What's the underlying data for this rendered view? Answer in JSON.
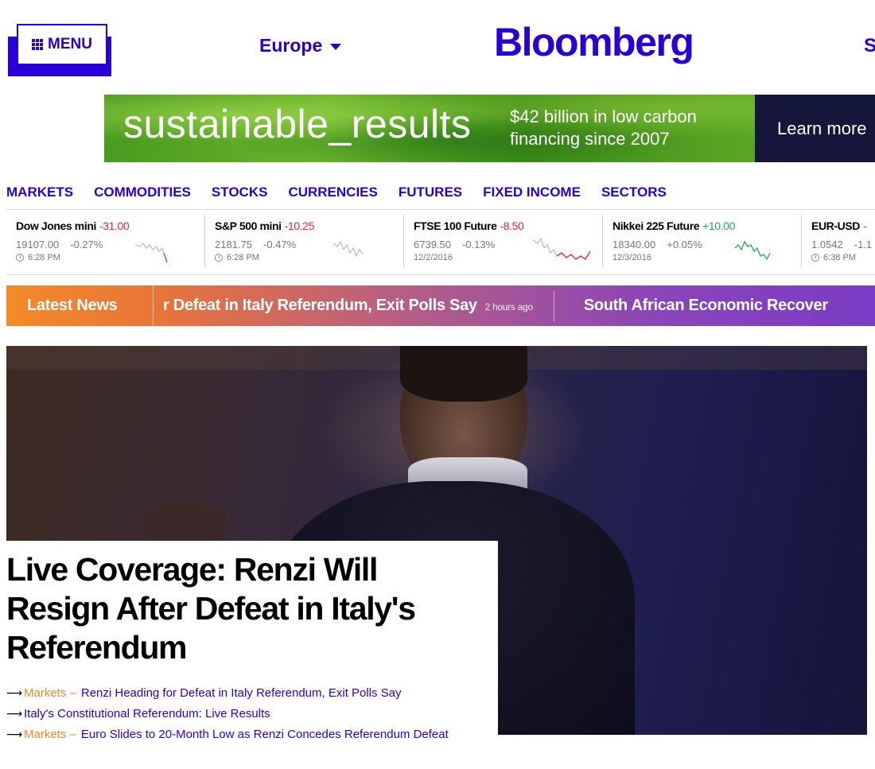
{
  "header": {
    "menu_label": "MENU",
    "region": "Europe",
    "logo": "Bloomberg",
    "edge_text": "S"
  },
  "ad": {
    "headline": "sustainable_results",
    "sub_line1": "$42 billion in low carbon",
    "sub_line2": "financing since 2007",
    "cta": "Learn more",
    "colors": {
      "green": "#5aa624",
      "dark": "#14163a"
    }
  },
  "nav": {
    "items": [
      "MARKETS",
      "COMMODITIES",
      "STOCKS",
      "CURRENCIES",
      "FUTURES",
      "FIXED INCOME",
      "SECTORS"
    ]
  },
  "tickers": [
    {
      "name": "Dow Jones mini",
      "change": "-31.00",
      "direction": "down",
      "price": "19107.00",
      "pct": "-0.27%",
      "time": "6:28 PM",
      "show_clock": true
    },
    {
      "name": "S&P 500 mini",
      "change": "-10.25",
      "direction": "down",
      "price": "2181.75",
      "pct": "-0.47%",
      "time": "6:28 PM",
      "show_clock": true
    },
    {
      "name": "FTSE 100 Future",
      "change": "-8.50",
      "direction": "down",
      "price": "6739.50",
      "pct": "-0.13%",
      "time": "12/2/2016",
      "show_clock": false
    },
    {
      "name": "Nikkei 225 Future",
      "change": "+10.00",
      "direction": "up",
      "price": "18340.00",
      "pct": "+0.05%",
      "time": "12/3/2016",
      "show_clock": false
    },
    {
      "name": "EUR-USD",
      "change": "-",
      "direction": "down",
      "price": "1.0542",
      "pct": "-1.1",
      "time": "6:38 PM",
      "show_clock": true
    }
  ],
  "latest": {
    "label": "Latest News",
    "items": [
      {
        "text": "r Defeat in Italy Referendum, Exit Polls Say",
        "ago": "2 hours ago"
      },
      {
        "text": "South African Economic Recover",
        "ago": ""
      }
    ]
  },
  "hero": {
    "headline": "Live Coverage: Renzi Will Resign After Defeat in Italy's Referendum",
    "related": [
      {
        "category": "Markets –",
        "text": "Renzi Heading for Defeat in Italy Referendum, Exit Polls Say"
      },
      {
        "category": "",
        "text": "Italy's Constitutional Referendum: Live Results"
      },
      {
        "category": "Markets –",
        "text": "Euro Slides to 20-Month Low as Renzi Concedes Referendum Defeat"
      }
    ]
  },
  "colors": {
    "brand": "#2800d7",
    "negative": "#e8262c",
    "positive": "#1aae4c",
    "category": "#f08a2a"
  }
}
